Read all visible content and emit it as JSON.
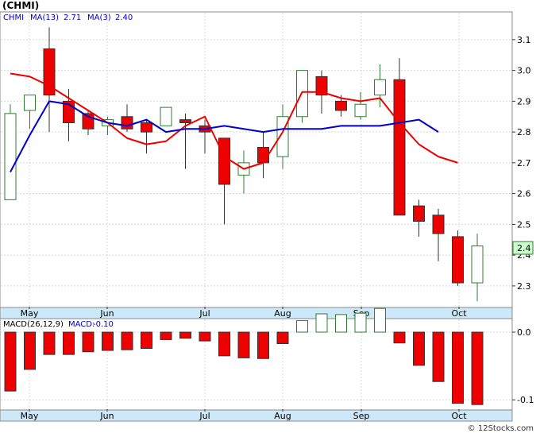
{
  "ticker_label": "(CHMI)",
  "legend": {
    "symbol": "CHMI",
    "ma13_label": "MA(13)",
    "ma13_value": "2.71",
    "ma3_label": "MA(3)",
    "ma3_value": "2.40",
    "macd_params": "MACD(26,12,9)",
    "macd_label": "MACD:",
    "macd_value": "-0.10"
  },
  "current_price_label": "2.4",
  "watermark": "© 12Stocks.com",
  "colors": {
    "up_candle": "#2e7d32",
    "down_candle": "#ee0000",
    "ma13_line": "#ee0000",
    "ma3_line": "#0000cc",
    "axis_strip": "#cde8f8",
    "grid": "#d9d9d9",
    "price_tag_bg": "#ccffcc"
  },
  "chart_data": [
    {
      "type": "candlestick",
      "x_ticks": [
        "May",
        "Jun",
        "Jul",
        "Aug",
        "Sep",
        "Oct"
      ],
      "y_ticks": [
        "2.3",
        "2.4",
        "2.5",
        "2.6",
        "2.7",
        "2.8",
        "2.9",
        "3.0",
        "3.1"
      ],
      "ylim": [
        2.23,
        3.19
      ],
      "grid": true,
      "candles": [
        {
          "open": 2.58,
          "high": 2.89,
          "low": 2.58,
          "close": 2.86
        },
        {
          "open": 2.87,
          "high": 2.92,
          "low": 2.81,
          "close": 2.92
        },
        {
          "open": 3.07,
          "high": 3.14,
          "low": 2.8,
          "close": 2.92
        },
        {
          "open": 2.9,
          "high": 2.94,
          "low": 2.77,
          "close": 2.83
        },
        {
          "open": 2.86,
          "high": 2.87,
          "low": 2.79,
          "close": 2.81
        },
        {
          "open": 2.82,
          "high": 2.85,
          "low": 2.79,
          "close": 2.84
        },
        {
          "open": 2.85,
          "high": 2.89,
          "low": 2.8,
          "close": 2.81
        },
        {
          "open": 2.83,
          "high": 2.84,
          "low": 2.73,
          "close": 2.8
        },
        {
          "open": 2.82,
          "high": 2.88,
          "low": 2.82,
          "close": 2.88
        },
        {
          "open": 2.84,
          "high": 2.86,
          "low": 2.68,
          "close": 2.83
        },
        {
          "open": 2.82,
          "high": 2.84,
          "low": 2.73,
          "close": 2.8
        },
        {
          "open": 2.78,
          "high": 2.78,
          "low": 2.5,
          "close": 2.63
        },
        {
          "open": 2.66,
          "high": 2.74,
          "low": 2.6,
          "close": 2.7
        },
        {
          "open": 2.75,
          "high": 2.8,
          "low": 2.65,
          "close": 2.7
        },
        {
          "open": 2.72,
          "high": 2.89,
          "low": 2.68,
          "close": 2.85
        },
        {
          "open": 2.85,
          "high": 3.0,
          "low": 2.83,
          "close": 3.0
        },
        {
          "open": 2.98,
          "high": 3.0,
          "low": 2.86,
          "close": 2.92
        },
        {
          "open": 2.9,
          "high": 2.92,
          "low": 2.85,
          "close": 2.87
        },
        {
          "open": 2.85,
          "high": 2.93,
          "low": 2.84,
          "close": 2.89
        },
        {
          "open": 2.92,
          "high": 3.02,
          "low": 2.88,
          "close": 2.97
        },
        {
          "open": 2.97,
          "high": 3.04,
          "low": 2.53,
          "close": 2.53
        },
        {
          "open": 2.56,
          "high": 2.58,
          "low": 2.46,
          "close": 2.51
        },
        {
          "open": 2.53,
          "high": 2.55,
          "low": 2.38,
          "close": 2.47
        },
        {
          "open": 2.46,
          "high": 2.48,
          "low": 2.3,
          "close": 2.31
        },
        {
          "open": 2.31,
          "high": 2.47,
          "low": 2.25,
          "close": 2.43
        }
      ],
      "ma13": [
        2.99,
        2.98,
        2.95,
        2.91,
        2.87,
        2.83,
        2.78,
        2.76,
        2.77,
        2.82,
        2.85,
        2.72,
        2.68,
        2.7,
        2.8,
        2.93,
        2.93,
        2.91,
        2.9,
        2.91,
        2.83,
        2.76,
        2.72,
        2.7
      ],
      "ma3": [
        2.67,
        2.79,
        2.9,
        2.89,
        2.85,
        2.83,
        2.82,
        2.84,
        2.8,
        2.81,
        2.81,
        2.82,
        2.81,
        2.8,
        2.81,
        2.81,
        2.81,
        2.82,
        2.82,
        2.82,
        2.83,
        2.84,
        2.8
      ]
    },
    {
      "type": "bar",
      "title": "MACD(26,12,9)",
      "y_ticks": [
        "0.0",
        "-0.1"
      ],
      "ylim": [
        -0.115,
        0.02
      ],
      "values": [
        -0.087,
        -0.055,
        -0.033,
        -0.033,
        -0.029,
        -0.027,
        -0.026,
        -0.024,
        -0.011,
        -0.009,
        -0.013,
        -0.035,
        -0.038,
        -0.039,
        -0.017,
        0.017,
        0.027,
        0.026,
        0.028,
        0.035,
        -0.016,
        -0.049,
        -0.073,
        -0.105,
        -0.107
      ]
    }
  ]
}
